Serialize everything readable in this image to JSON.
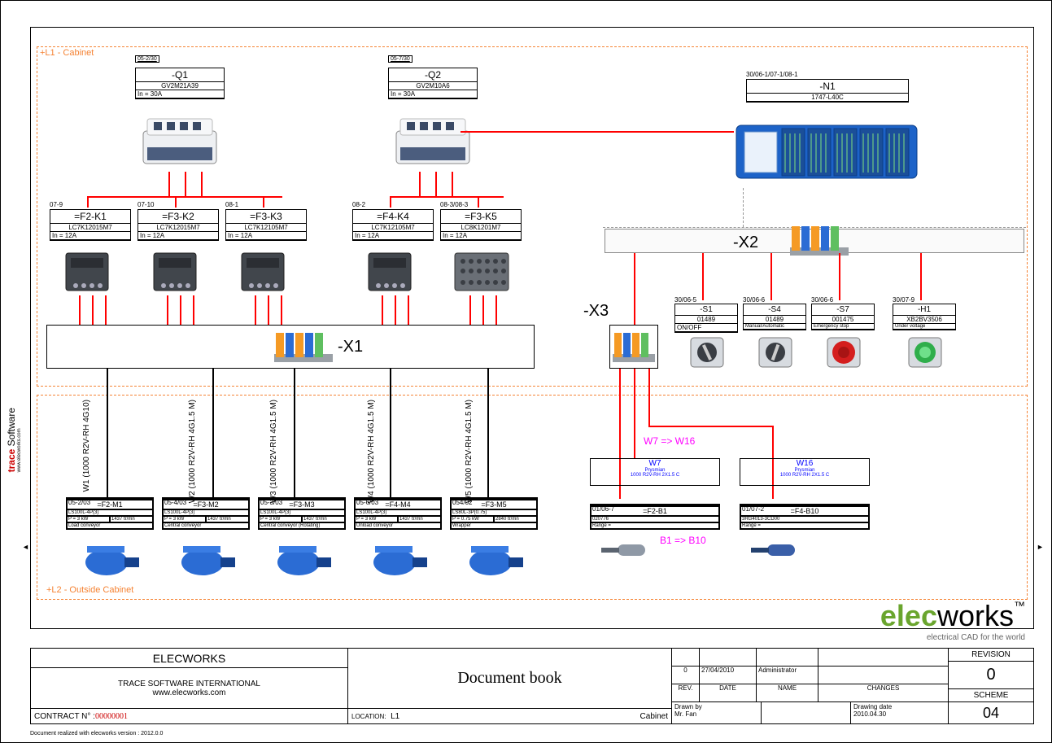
{
  "zones": {
    "l1": "+L1 - Cabinet",
    "l2": "+L2 - Outside Cabinet"
  },
  "q1": {
    "xref": "05-2/30",
    "tag": "-Q1",
    "pn": "GV2M21A39",
    "rating": "In = 30A"
  },
  "q2": {
    "xref": "05-7/30",
    "tag": "-Q2",
    "pn": "GV2M10A6",
    "rating": "In = 30A"
  },
  "n1": {
    "xref": "30/06-1/07-1/08-1",
    "tag": "-N1",
    "pn": "1747-L40C"
  },
  "k1": {
    "xref": "07-9",
    "tag": "=F2-K1",
    "pn": "LC7K12015M7",
    "rating": "In = 12A"
  },
  "k2": {
    "xref": "07-10",
    "tag": "=F3-K2",
    "pn": "LC7K12015M7",
    "rating": "In = 12A"
  },
  "k3": {
    "xref": "08-1",
    "tag": "=F3-K3",
    "pn": "LC7K12105M7",
    "rating": "In = 12A"
  },
  "k4": {
    "xref": "08-2",
    "tag": "=F4-K4",
    "pn": "LC7K12105M7",
    "rating": "In = 12A"
  },
  "k5": {
    "xref": "08-3/08-3",
    "tag": "=F3-K5",
    "pn": "LC8K1201M7",
    "rating": "In = 12A"
  },
  "x1": "-X1",
  "x2": "-X2",
  "x3": "-X3",
  "s1": {
    "xref": "30/06-5",
    "tag": "-S1",
    "pn": "01489",
    "fn": "ON/OFF"
  },
  "s4": {
    "xref": "30/06-6",
    "tag": "-S4",
    "pn": "01489",
    "fn": "Manual/Automatic"
  },
  "s7": {
    "xref": "30/06-6",
    "tag": "-S7",
    "pn": "001475",
    "fn": "Emergency stop"
  },
  "h1": {
    "xref": "30/07-9",
    "tag": "-H1",
    "pn": "XB2BV3506",
    "fn": "Under voltage"
  },
  "wires": {
    "w1": "W1 (1000 R2V-RH 4G10)",
    "w2": "W2 (1000 R2V-RH 4G1.5 M)",
    "w3": "W3 (1000 R2V-RH 4G1.5 M)",
    "w4": "W4 (1000 R2V-RH 4G1.5 M)",
    "w5": "W5 (1000 R2V-RH 4G1.5 M)"
  },
  "w7": {
    "tag": "W7",
    "mfr": "Prysmian",
    "spec": "1000 R2V-RH 2X1.5 C"
  },
  "w16": {
    "tag": "W16",
    "mfr": "Prysmian",
    "spec": "1000 R2V-RH 2X1.5 C"
  },
  "note_w": "W7 => W16",
  "note_b": "B1 => B10",
  "m1": {
    "xref": "05-2/03",
    "tag": "=F2-M1",
    "pn": "LS100L-4P(3)",
    "p": "P = 3 kW",
    "rpm": "1437 tr/mn",
    "fn": "Load conveyor"
  },
  "m2": {
    "xref": "05-4/03",
    "tag": "=F3-M2",
    "pn": "LS100L-4P(3)",
    "p": "P = 3 kW",
    "rpm": "1437 tr/mn",
    "fn": "Central conveyor"
  },
  "m3": {
    "xref": "05-3/03",
    "tag": "=F3-M3",
    "pn": "LS100L-4P(3)",
    "p": "P = 3 kW",
    "rpm": "1437 tr/mn",
    "fn": "Central conveyor (Rotating)"
  },
  "m4": {
    "xref": "05-6/03",
    "tag": "=F4-M4",
    "pn": "LS100L-4P(3)",
    "p": "P = 3 kW",
    "rpm": "1437 tr/mn",
    "fn": "Unload conveyor"
  },
  "m5": {
    "xref": "054/02",
    "tag": "=F3-M5",
    "pn": "LS80L-3P(0.75)",
    "p": "P = 0.75 kW",
    "rpm": "2840 tr/mn",
    "fn": "Wrapper"
  },
  "b1": {
    "xref": "01/06-7",
    "tag": "=F2-B1",
    "pn": "020776",
    "range": "Range ="
  },
  "b10": {
    "xref": "01/07-2",
    "tag": "=F4-B10",
    "pn": "3RG4013-3CD00",
    "range": "Range ="
  },
  "logo": {
    "part1": "elec",
    "part2": "works",
    "tm": "™",
    "tagline": "electrical CAD for the world"
  },
  "titleblock": {
    "company": "ELECWORKS",
    "org": "TRACE SOFTWARE INTERNATIONAL",
    "web": "www.elecworks.com",
    "contract_lbl": "CONTRACT N° : ",
    "contract": "00000001",
    "doc_title": "Document book",
    "location_lbl": "LOCATION:",
    "location": "L1",
    "cabinet": "Cabinet",
    "revtbl": {
      "rev": "0",
      "date": "27/04/2010",
      "name": "Administrator",
      "hdr_rev": "REV.",
      "hdr_date": "DATE",
      "hdr_name": "NAME",
      "hdr_changes": "CHANGES"
    },
    "drawn_by_lbl": "Drawn by",
    "drawn_by": "Mr. Fan",
    "drawdate_lbl": "Drawing date",
    "drawdate": "2010.04.30",
    "revision_lbl": "REVISION",
    "revision": "0",
    "scheme_lbl": "SCHEME",
    "scheme": "04"
  },
  "brand": {
    "t1": "trace",
    "t2": "Software",
    "url": "www.elecworks.com"
  },
  "footer": "Document realized with elecworks version :  2012.0.0",
  "arrows": {
    "left": "◄",
    "right": "►"
  }
}
